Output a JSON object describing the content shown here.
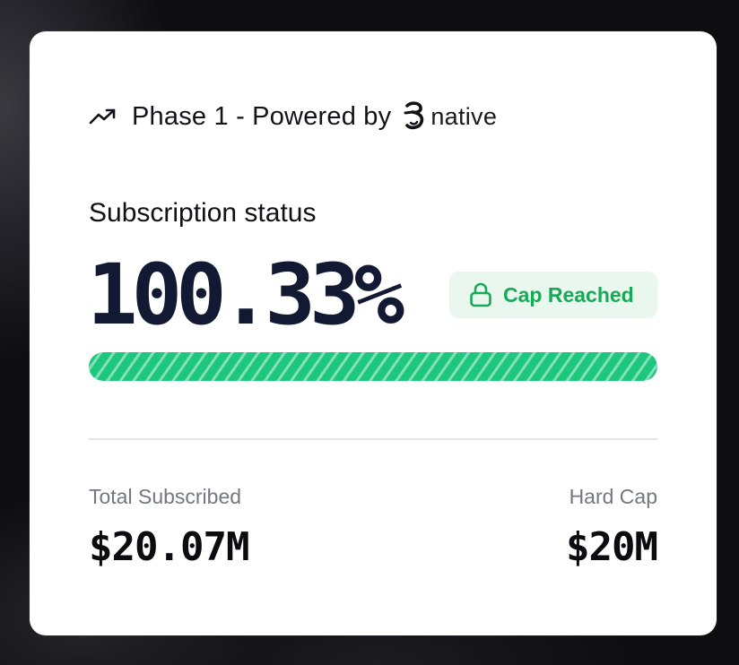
{
  "header": {
    "phase_text": "Phase 1 - Powered by",
    "trend_icon": "trending-up-icon",
    "brand": {
      "name": "native",
      "logo_icon": "native-logo-icon"
    }
  },
  "subscription": {
    "label": "Subscription status",
    "percent_text": "100.33%",
    "percent_value": 100.33,
    "badge": {
      "label": "Cap Reached",
      "icon": "lock-icon"
    },
    "progress_fraction": 1.0
  },
  "stats": {
    "total_subscribed": {
      "label": "Total Subscribed",
      "value": "$20.07M"
    },
    "hard_cap": {
      "label": "Hard Cap",
      "value": "$20M"
    }
  },
  "colors": {
    "accent_green": "#1ec77e",
    "badge_text_green": "#18a957",
    "badge_background": "#eaf7ef",
    "headline_navy": "#121a33",
    "card_background": "#ffffff",
    "page_background": "#0e0e10"
  }
}
